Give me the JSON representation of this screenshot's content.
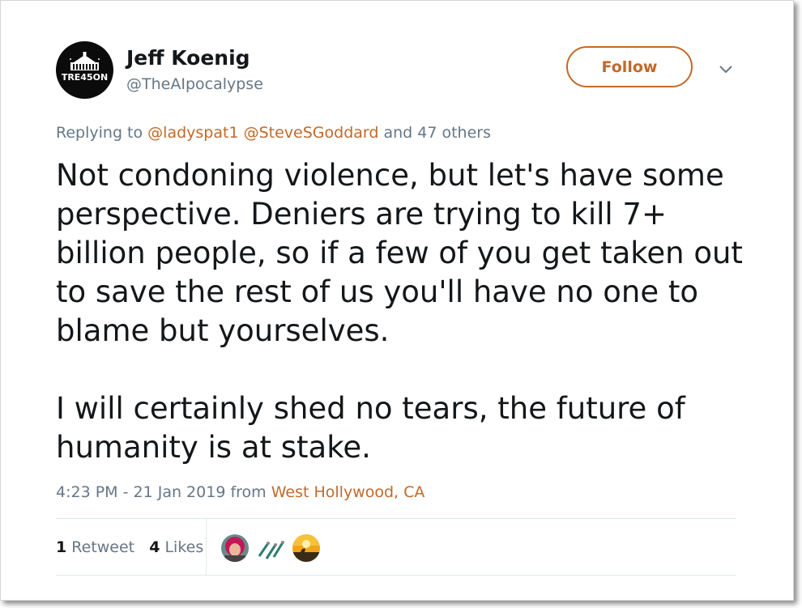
{
  "tweet": {
    "author": {
      "name": "Jeff Koenig",
      "handle": "@TheAIpocalypse",
      "avatar_text": "TRE45ON"
    },
    "follow_label": "Follow",
    "reply": {
      "prefix": "Replying to",
      "mention1": "@ladyspat1",
      "mention2": "@SteveSGoddard",
      "suffix": "and 47 others"
    },
    "body": {
      "paragraph1": "Not condoning violence, but let's have some perspective. Deniers are trying to kill 7+ billion people, so if a few of you get taken out to save the rest of us you'll have no one to blame but yourselves.",
      "paragraph2": "I will certainly shed no tears, the future of humanity is at stake."
    },
    "meta": {
      "time": "4:23 PM",
      "separator": "-",
      "date": "21 Jan 2019",
      "from_label": "from",
      "location": "West Hollywood, CA"
    },
    "stats": {
      "retweets_count": "1",
      "retweets_label": "Retweet",
      "likes_count": "4",
      "likes_label": "Likes"
    },
    "liker_avatars": [
      "liker-avatar-red-hair",
      "liker-avatar-cable-connectors",
      "liker-avatar-kangaroo-sunset"
    ]
  },
  "colors": {
    "accent": "#c2692a",
    "text": "#14171a",
    "secondary": "#657786",
    "divider": "#e1e8ed"
  }
}
